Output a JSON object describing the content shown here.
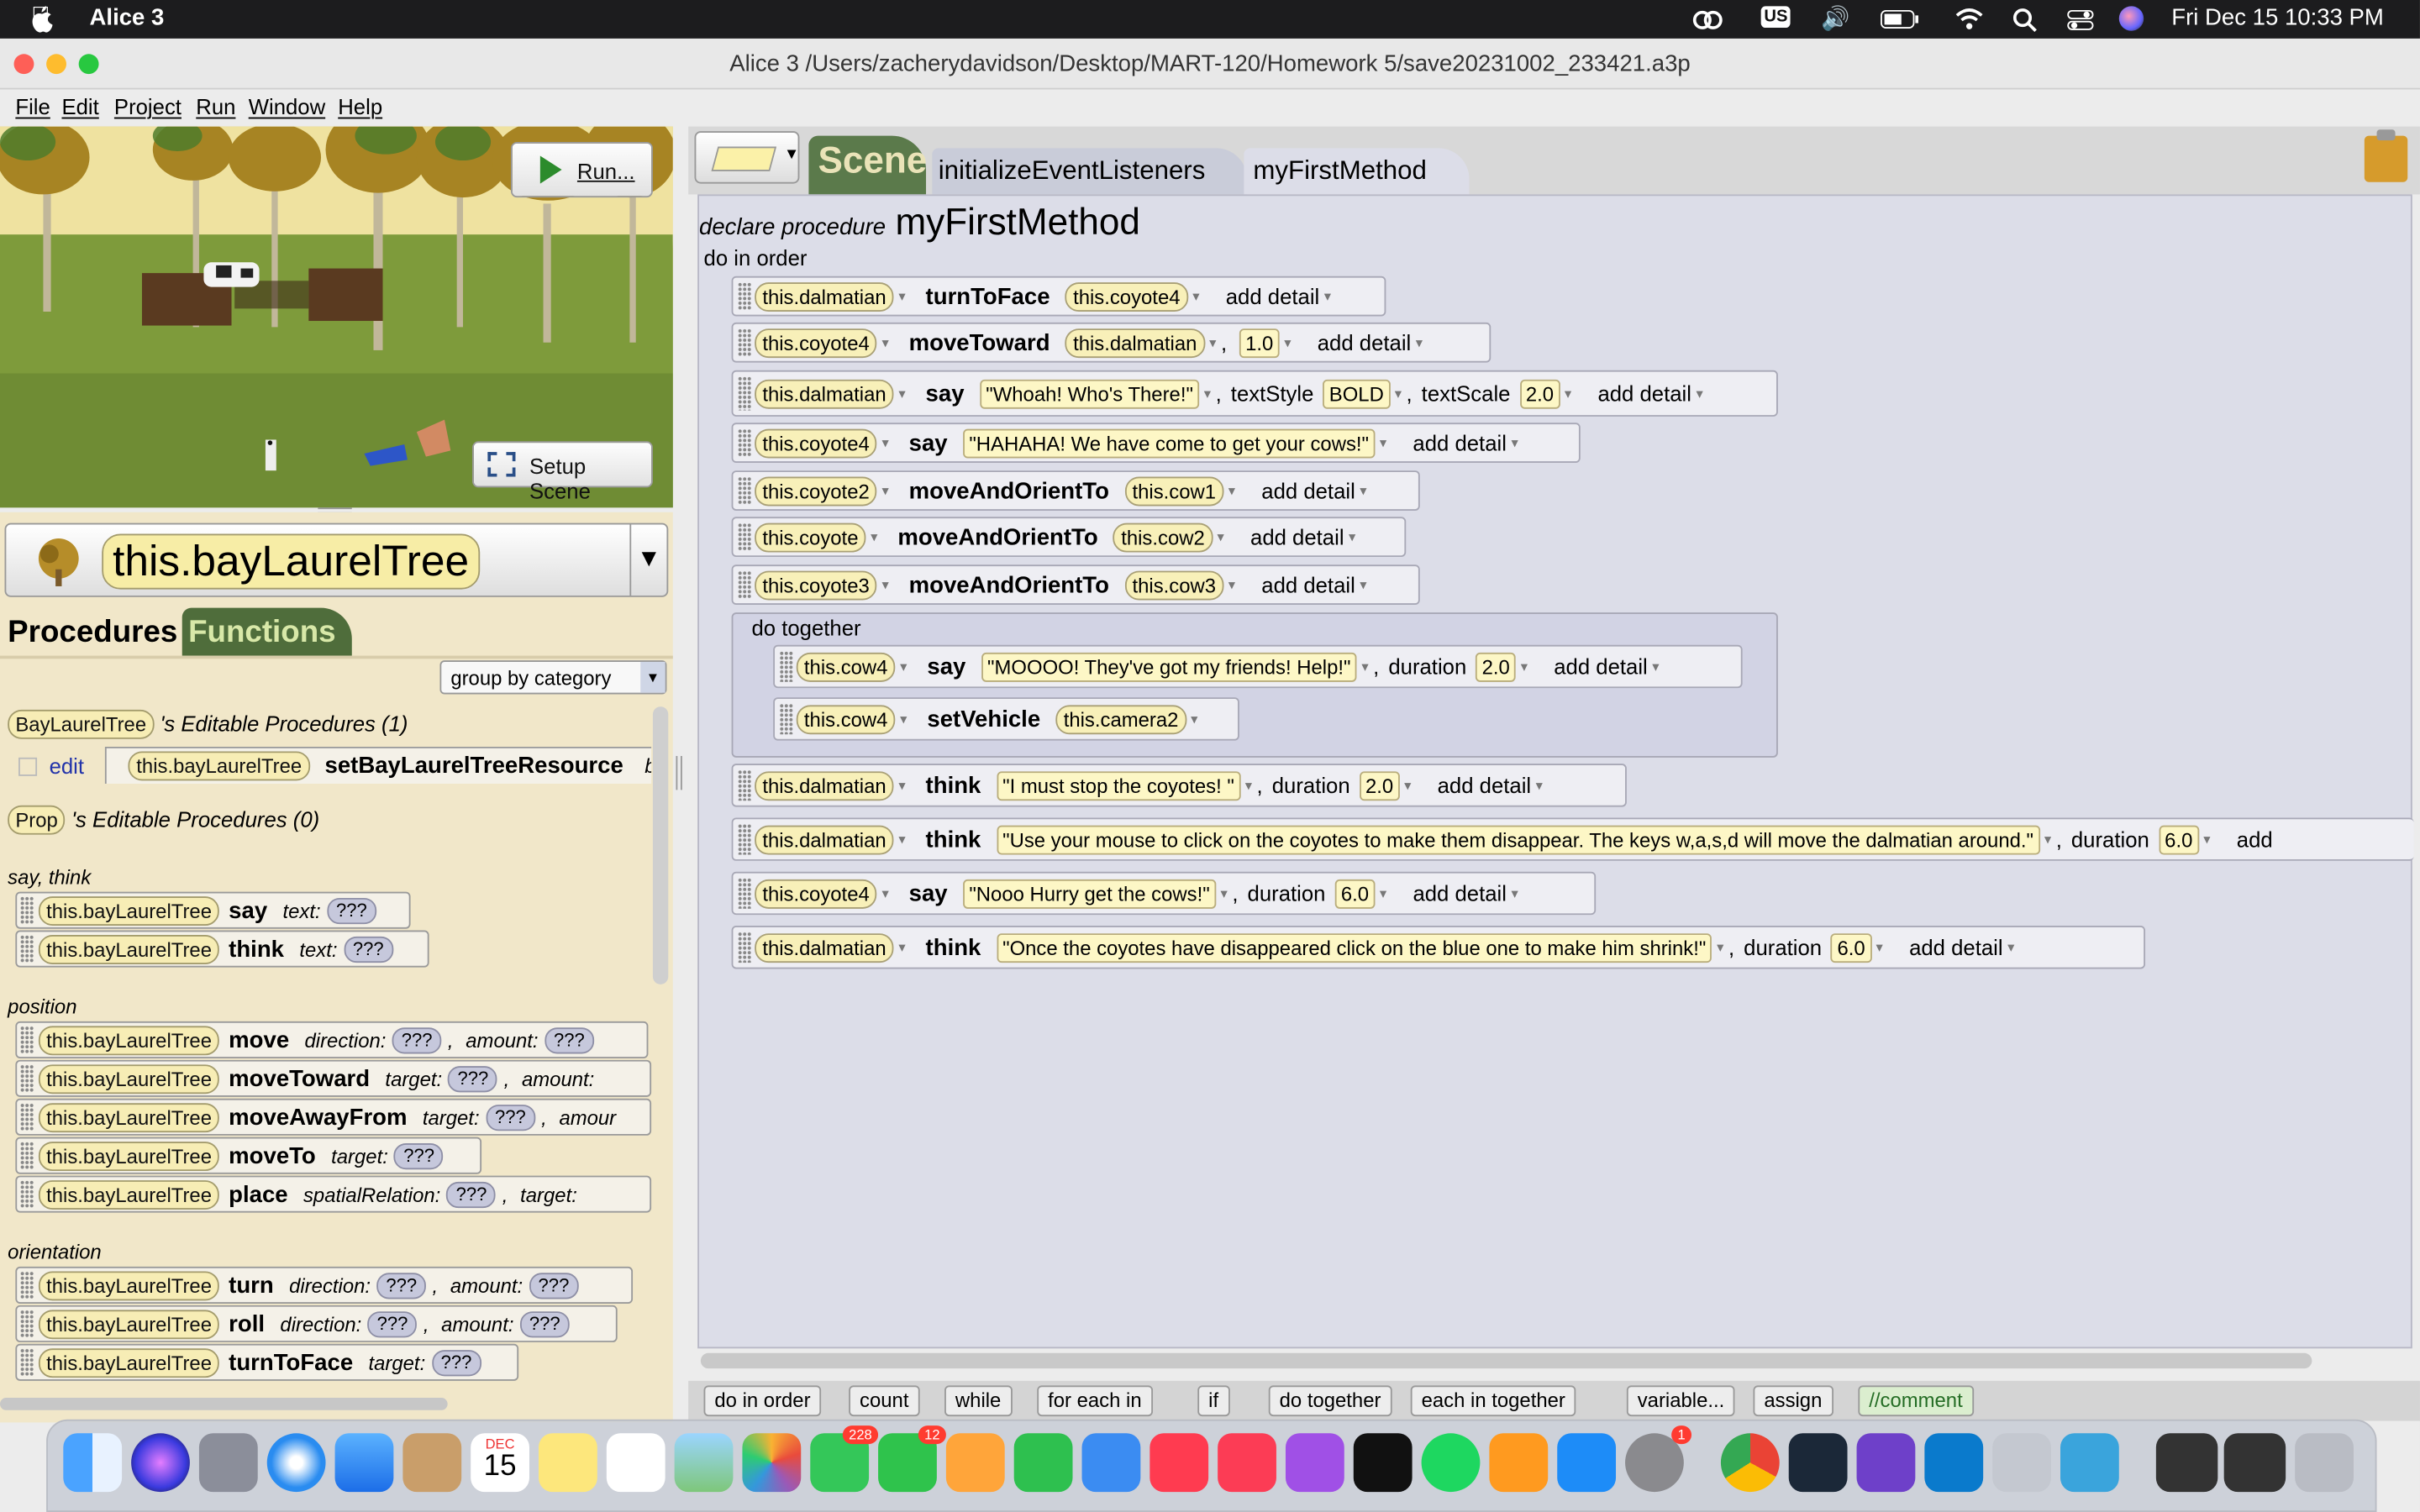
{
  "menubar": {
    "app": "Alice 3",
    "status": {
      "input": "US",
      "datetime": "Fri Dec 15  10:33 PM"
    }
  },
  "window": {
    "title": "Alice 3 /Users/zacherydavidson/Desktop/MART-120/Homework 5/save20231002_233421.a3p"
  },
  "app_menu": [
    "File",
    "Edit",
    "Project",
    "Run",
    "Window",
    "Help"
  ],
  "scene_view": {
    "run_label": "Run...",
    "setup_label": "Setup Scene"
  },
  "selector": {
    "name": "this.bayLaurelTree"
  },
  "left_tabs": {
    "procedures": "Procedures",
    "functions": "Functions"
  },
  "group_by": "group by category",
  "editable": {
    "type1": "BayLaurelTree",
    "type1_text": "'s Editable Procedures (1)",
    "edit": "edit",
    "edit_obj": "this.bayLaurelTree",
    "edit_method": "setBayLaurelTreeResource",
    "edit_tail": "b",
    "type2": "Prop",
    "type2_text": "'s Editable Procedures (0)"
  },
  "categories": {
    "saythink": "say, think",
    "position": "position",
    "orientation": "orientation"
  },
  "palette": {
    "obj": "this.bayLaurelTree",
    "q": "???",
    "say": "say",
    "think": "think",
    "text": "text:",
    "move": "move",
    "direction": "direction:",
    "amount": "amount:",
    "moveToward": "moveToward",
    "target": "target:",
    "amount_tail": "amount:",
    "moveAwayFrom": "moveAwayFrom",
    "amoun": "amour",
    "moveTo": "moveTo",
    "place": "place",
    "spatialRelation": "spatialRelation:",
    "target_tail": "target:",
    "turn": "turn",
    "roll": "roll",
    "turnToFace": "turnToFace",
    "comma": ","
  },
  "tabs": {
    "scene": "Scene",
    "init": "initializeEventListeners",
    "method": "myFirstMethod"
  },
  "code": {
    "declare": "declare procedure",
    "method_name": "myFirstMethod",
    "do_in_order": "do in order",
    "do_together": "do together",
    "add_detail": "add detail",
    "duration": "duration",
    "textStyle": "textStyle",
    "textScale": "textScale",
    "comma": ",",
    "add_cut": "add",
    "s1": {
      "obj": "this.dalmatian",
      "m": "turnToFace",
      "arg": "this.coyote4"
    },
    "s2": {
      "obj": "this.coyote4",
      "m": "moveToward",
      "arg": "this.dalmatian",
      "num": "1.0"
    },
    "s3": {
      "obj": "this.dalmatian",
      "m": "say",
      "str": "\"Whoah! Who's There!\"",
      "style": "BOLD",
      "scale": "2.0"
    },
    "s4": {
      "obj": "this.coyote4",
      "m": "say",
      "str": "\"HAHAHA! We have come to get your cows!\""
    },
    "s5": {
      "obj": "this.coyote2",
      "m": "moveAndOrientTo",
      "arg": "this.cow1"
    },
    "s6": {
      "obj": "this.coyote",
      "m": "moveAndOrientTo",
      "arg": "this.cow2"
    },
    "s7": {
      "obj": "this.coyote3",
      "m": "moveAndOrientTo",
      "arg": "this.cow3"
    },
    "t1": {
      "obj": "this.cow4",
      "m": "say",
      "str": "\"MOOOO! They've got my friends! Help!\"",
      "dur": "2.0"
    },
    "t2": {
      "obj": "this.cow4",
      "m": "setVehicle",
      "arg": "this.camera2"
    },
    "s8": {
      "obj": "this.dalmatian",
      "m": "think",
      "str": "\"I must stop the coyotes! \"",
      "dur": "2.0"
    },
    "s9": {
      "obj": "this.dalmatian",
      "m": "think",
      "str": "\"Use your mouse to click on the coyotes to make them disappear. The keys w,a,s,d will move the dalmatian around.\"",
      "dur": "6.0"
    },
    "s10": {
      "obj": "this.coyote4",
      "m": "say",
      "str": "\"Nooo Hurry get the cows!\"",
      "dur": "6.0"
    },
    "s11": {
      "obj": "this.dalmatian",
      "m": "think",
      "str": "\"Once the coyotes have disappeared click on the blue one to make him shrink!\"",
      "dur": "6.0"
    }
  },
  "toolbox": [
    "do in order",
    "count",
    "while",
    "for each in",
    "if",
    "do together",
    "each in together",
    "variable...",
    "assign",
    "//comment"
  ],
  "dock": {
    "calendar_month": "DEC",
    "calendar_day": "15",
    "messages_badge": "228",
    "facetime_badge": "12",
    "settings_badge": "1"
  }
}
